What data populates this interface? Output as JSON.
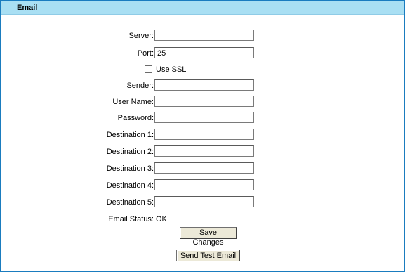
{
  "panel": {
    "title": "Email",
    "header_color": "#a9dff3",
    "border_color": "#1a7cbf"
  },
  "form": {
    "server": {
      "label": "Server:",
      "value": ""
    },
    "port": {
      "label": "Port:",
      "value": "25"
    },
    "use_ssl": {
      "label": "Use SSL",
      "checked": false
    },
    "sender": {
      "label": "Sender:",
      "value": ""
    },
    "user_name": {
      "label": "User Name:",
      "value": ""
    },
    "password": {
      "label": "Password:",
      "value": ""
    },
    "destinations": [
      {
        "label": "Destination 1:",
        "value": ""
      },
      {
        "label": "Destination 2:",
        "value": ""
      },
      {
        "label": "Destination 3:",
        "value": ""
      },
      {
        "label": "Destination 4:",
        "value": ""
      },
      {
        "label": "Destination 5:",
        "value": ""
      }
    ],
    "email_status": {
      "label": "Email Status:",
      "value": "OK"
    }
  },
  "buttons": {
    "save_label": "Save Changes",
    "send_test_label": "Send Test Email"
  }
}
